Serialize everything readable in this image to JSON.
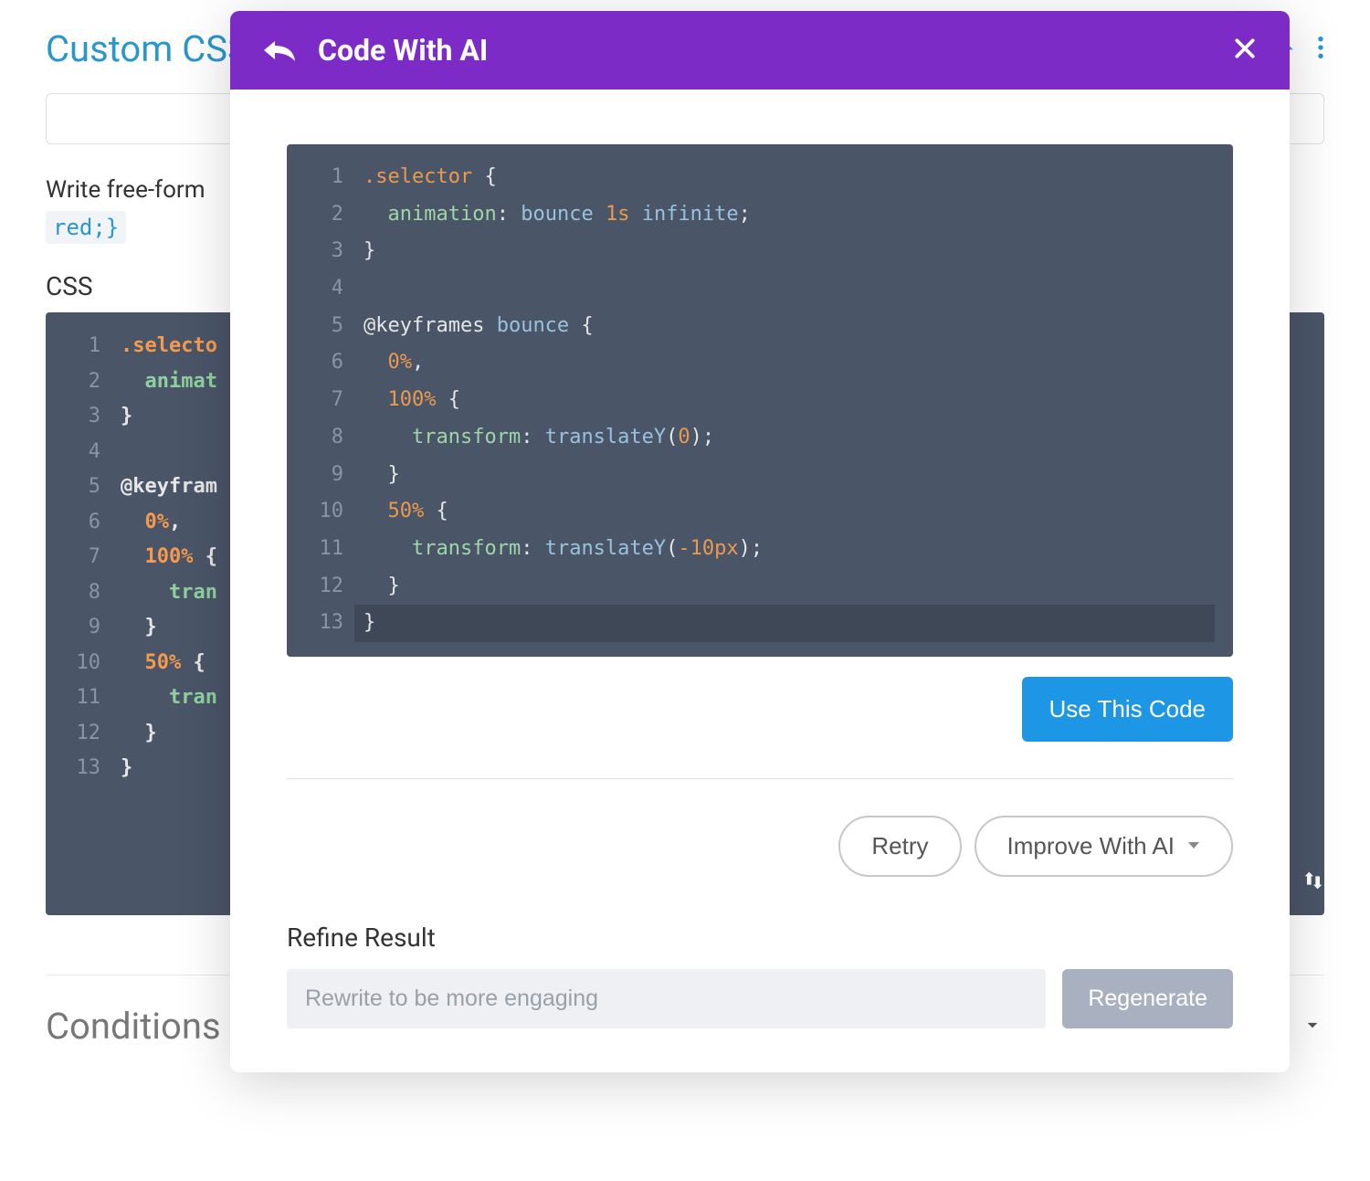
{
  "bg": {
    "title": "Custom CSS",
    "hint_label": "Write free-form",
    "inline_code": "red;}",
    "css_label": "CSS",
    "conditions_title": "Conditions",
    "code_lines": [
      {
        "n": "1",
        "tokens": [
          {
            "t": ".selecto",
            "c": "c-sel"
          }
        ],
        "bold": true
      },
      {
        "n": "2",
        "tokens": [
          {
            "t": "  ",
            "c": ""
          },
          {
            "t": "animat",
            "c": "c-prop"
          }
        ],
        "bold": true
      },
      {
        "n": "3",
        "tokens": [
          {
            "t": "}",
            "c": "c-punc"
          }
        ],
        "bold": true
      },
      {
        "n": "4",
        "tokens": [],
        "bold": false
      },
      {
        "n": "5",
        "tokens": [
          {
            "t": "@keyfram",
            "c": "c-punc"
          }
        ],
        "bold": true
      },
      {
        "n": "6",
        "tokens": [
          {
            "t": "  ",
            "c": ""
          },
          {
            "t": "0%",
            "c": "c-num"
          },
          {
            "t": ",",
            "c": "c-punc"
          }
        ],
        "bold": true
      },
      {
        "n": "7",
        "tokens": [
          {
            "t": "  ",
            "c": ""
          },
          {
            "t": "100%",
            "c": "c-num"
          },
          {
            "t": " {",
            "c": "c-punc"
          }
        ],
        "bold": true
      },
      {
        "n": "8",
        "tokens": [
          {
            "t": "    ",
            "c": ""
          },
          {
            "t": "tran",
            "c": "c-prop"
          }
        ],
        "bold": true
      },
      {
        "n": "9",
        "tokens": [
          {
            "t": "  }",
            "c": "c-punc"
          }
        ],
        "bold": true
      },
      {
        "n": "10",
        "tokens": [
          {
            "t": "  ",
            "c": ""
          },
          {
            "t": "50%",
            "c": "c-num"
          },
          {
            "t": " {",
            "c": "c-punc"
          }
        ],
        "bold": true
      },
      {
        "n": "11",
        "tokens": [
          {
            "t": "    ",
            "c": ""
          },
          {
            "t": "tran",
            "c": "c-prop"
          }
        ],
        "bold": true
      },
      {
        "n": "12",
        "tokens": [
          {
            "t": "  }",
            "c": "c-punc"
          }
        ],
        "bold": true
      },
      {
        "n": "13",
        "tokens": [
          {
            "t": "}",
            "c": "c-punc"
          }
        ],
        "bold": true
      }
    ]
  },
  "modal": {
    "title": "Code With AI",
    "use_button": "Use This Code",
    "retry_button": "Retry",
    "improve_button": "Improve With AI",
    "refine_label": "Refine Result",
    "refine_placeholder": "Rewrite to be more engaging",
    "regenerate_button": "Regenerate",
    "code_lines": [
      {
        "n": "1",
        "tokens": [
          {
            "t": ".selector",
            "c": "m-sel"
          },
          {
            "t": " {",
            "c": "m-punc"
          }
        ]
      },
      {
        "n": "2",
        "tokens": [
          {
            "t": "  ",
            "c": ""
          },
          {
            "t": "animation",
            "c": "m-prop"
          },
          {
            "t": ": ",
            "c": "m-punc"
          },
          {
            "t": "bounce",
            "c": "m-val"
          },
          {
            "t": " ",
            "c": ""
          },
          {
            "t": "1s",
            "c": "m-num"
          },
          {
            "t": " ",
            "c": ""
          },
          {
            "t": "infinite",
            "c": "m-val"
          },
          {
            "t": ";",
            "c": "m-punc"
          }
        ]
      },
      {
        "n": "3",
        "tokens": [
          {
            "t": "}",
            "c": "m-punc"
          }
        ]
      },
      {
        "n": "4",
        "tokens": []
      },
      {
        "n": "5",
        "tokens": [
          {
            "t": "@keyframes",
            "c": "m-at"
          },
          {
            "t": " ",
            "c": ""
          },
          {
            "t": "bounce",
            "c": "m-val"
          },
          {
            "t": " {",
            "c": "m-punc"
          }
        ]
      },
      {
        "n": "6",
        "tokens": [
          {
            "t": "  ",
            "c": ""
          },
          {
            "t": "0%",
            "c": "m-pct"
          },
          {
            "t": ",",
            "c": "m-punc"
          }
        ]
      },
      {
        "n": "7",
        "tokens": [
          {
            "t": "  ",
            "c": ""
          },
          {
            "t": "100%",
            "c": "m-pct"
          },
          {
            "t": " {",
            "c": "m-punc"
          }
        ]
      },
      {
        "n": "8",
        "tokens": [
          {
            "t": "    ",
            "c": ""
          },
          {
            "t": "transform",
            "c": "m-prop"
          },
          {
            "t": ": ",
            "c": "m-punc"
          },
          {
            "t": "translateY",
            "c": "m-func"
          },
          {
            "t": "(",
            "c": "m-paren"
          },
          {
            "t": "0",
            "c": "m-zero"
          },
          {
            "t": ")",
            "c": "m-paren"
          },
          {
            "t": ";",
            "c": "m-punc"
          }
        ]
      },
      {
        "n": "9",
        "tokens": [
          {
            "t": "  }",
            "c": "m-punc"
          }
        ]
      },
      {
        "n": "10",
        "tokens": [
          {
            "t": "  ",
            "c": ""
          },
          {
            "t": "50%",
            "c": "m-pct"
          },
          {
            "t": " {",
            "c": "m-punc"
          }
        ]
      },
      {
        "n": "11",
        "tokens": [
          {
            "t": "    ",
            "c": ""
          },
          {
            "t": "transform",
            "c": "m-prop"
          },
          {
            "t": ": ",
            "c": "m-punc"
          },
          {
            "t": "translateY",
            "c": "m-func"
          },
          {
            "t": "(",
            "c": "m-paren"
          },
          {
            "t": "-10px",
            "c": "m-neg"
          },
          {
            "t": ")",
            "c": "m-paren"
          },
          {
            "t": ";",
            "c": "m-punc"
          }
        ]
      },
      {
        "n": "12",
        "tokens": [
          {
            "t": "  }",
            "c": "m-punc"
          }
        ]
      },
      {
        "n": "13",
        "tokens": [
          {
            "t": "}",
            "c": "m-punc"
          }
        ],
        "hl": true
      }
    ]
  }
}
